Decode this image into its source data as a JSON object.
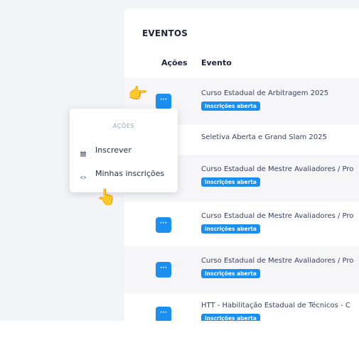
{
  "card": {
    "title": "EVENTOS",
    "columns": {
      "acoes": "Ações",
      "evento": "Evento"
    }
  },
  "rows": [
    {
      "name": "Curso Estadual de Arbitragem 2025",
      "badge": "Inscrições aberta"
    },
    {
      "name": "Seletiva Aberta e Grand Slam 2025",
      "badge": ""
    },
    {
      "name": "Curso Estadual de Mestre Avaliadores / Pro",
      "badge": "Inscrições aberta"
    },
    {
      "name": "Curso Estadual de Mestre Avaliadores / Pro",
      "badge": "Inscrições aberta"
    },
    {
      "name": "Curso Estadual de Mestre Avaliadores / Pro",
      "badge": "Inscrições aberta"
    },
    {
      "name": "HTT - Habilitação Estadual de Técnicos - C",
      "badge": "Inscrições aberta"
    }
  ],
  "action_button": {
    "label": "···"
  },
  "menu": {
    "header": "AÇÕES",
    "items": [
      {
        "label": "Inscrever",
        "icon": "calendar-icon"
      },
      {
        "label": "Minhas inscrições",
        "icon": "eye-icon"
      }
    ]
  },
  "colors": {
    "accent": "#1b8ff0",
    "row_alt": "#f6f6f8"
  },
  "annotations": {
    "pointer_right": "👉",
    "pointer_up": "👆"
  }
}
